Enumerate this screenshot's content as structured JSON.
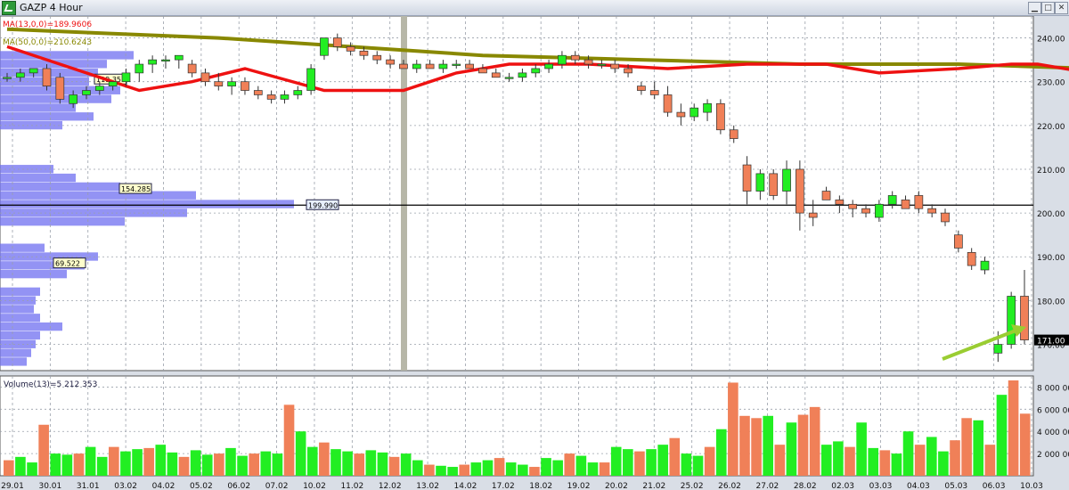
{
  "window": {
    "title": "GAZP 4 Hour",
    "min_label": "▁",
    "max_label": "□",
    "close_label": "✕"
  },
  "colors": {
    "bull": "#22ee22",
    "bear": "#f08058",
    "ma_fast": "#ee1111",
    "ma_slow": "#888800",
    "profile": "#6f6ff0",
    "grid": "#9aa0aa",
    "bg": "#ffffff",
    "highlight_arrow": "#9acd32"
  },
  "price_panel": {
    "ma_fast_label": "MA(13,0,0)=189.9606",
    "ma_slow_label": "MA(50,0,0)=210.6243",
    "current_price": "171.00",
    "ylim": [
      164,
      245
    ],
    "ticks": [
      170,
      180,
      190,
      200,
      210,
      220,
      230,
      240
    ],
    "tick_labels": [
      "170.00",
      "180.00",
      "190.00",
      "200.00",
      "210.00",
      "220.00",
      "230.00",
      "240.00"
    ],
    "hline": {
      "value": 201.8,
      "label": "199.990"
    },
    "profile_labels": [
      {
        "value": 230.5,
        "text": "119.351"
      },
      {
        "value": 205.5,
        "text": "154.285"
      },
      {
        "value": 188.5,
        "text": "69.522"
      }
    ]
  },
  "volume_panel": {
    "label": "Volume(13)=5 212 353",
    "ylim": [
      0,
      9000000
    ],
    "ticks": [
      2000000,
      4000000,
      6000000,
      8000000
    ],
    "tick_labels": [
      "2 000 000",
      "4 000 000",
      "6 000 000",
      "8 000 000"
    ]
  },
  "x_axis": {
    "labels": [
      "29.01",
      "30.01",
      "31.01",
      "03.02",
      "04.02",
      "05.02",
      "06.02",
      "07.02",
      "10.02",
      "11.02",
      "12.02",
      "13.02",
      "14.02",
      "17.02",
      "18.02",
      "19.02",
      "20.02",
      "21.02",
      "25.02",
      "26.02",
      "27.02",
      "28.02",
      "02.03",
      "03.03",
      "04.03",
      "05.03",
      "06.03",
      "10.03"
    ]
  },
  "chart_data": {
    "type": "candlestick",
    "title": "GAZP 4 Hour",
    "candles": [
      {
        "o": 231,
        "h": 232,
        "l": 230,
        "c": 231
      },
      {
        "o": 231,
        "h": 233,
        "l": 230,
        "c": 232
      },
      {
        "o": 232,
        "h": 233,
        "l": 231,
        "c": 233
      },
      {
        "o": 233,
        "h": 234,
        "l": 228,
        "c": 229
      },
      {
        "o": 231,
        "h": 232,
        "l": 225,
        "c": 226
      },
      {
        "o": 225,
        "h": 228,
        "l": 224,
        "c": 227
      },
      {
        "o": 227,
        "h": 229,
        "l": 226,
        "c": 228
      },
      {
        "o": 228,
        "h": 230,
        "l": 227,
        "c": 229
      },
      {
        "o": 229,
        "h": 230,
        "l": 228,
        "c": 230
      },
      {
        "o": 230,
        "h": 233,
        "l": 229,
        "c": 232
      },
      {
        "o": 232,
        "h": 235,
        "l": 230,
        "c": 234
      },
      {
        "o": 234,
        "h": 236,
        "l": 232,
        "c": 235
      },
      {
        "o": 235,
        "h": 236,
        "l": 233,
        "c": 235
      },
      {
        "o": 235,
        "h": 236,
        "l": 233,
        "c": 236
      },
      {
        "o": 234,
        "h": 235,
        "l": 231,
        "c": 232
      },
      {
        "o": 232,
        "h": 233,
        "l": 229,
        "c": 230
      },
      {
        "o": 230,
        "h": 232,
        "l": 228,
        "c": 229
      },
      {
        "o": 229,
        "h": 231,
        "l": 227,
        "c": 230
      },
      {
        "o": 230,
        "h": 231,
        "l": 227,
        "c": 228
      },
      {
        "o": 228,
        "h": 229,
        "l": 226,
        "c": 227
      },
      {
        "o": 227,
        "h": 228,
        "l": 225,
        "c": 226
      },
      {
        "o": 226,
        "h": 228,
        "l": 225,
        "c": 227
      },
      {
        "o": 227,
        "h": 229,
        "l": 226,
        "c": 228
      },
      {
        "o": 228,
        "h": 234,
        "l": 227,
        "c": 233
      },
      {
        "o": 236,
        "h": 240,
        "l": 235,
        "c": 240
      },
      {
        "o": 240,
        "h": 241,
        "l": 237,
        "c": 238
      },
      {
        "o": 238,
        "h": 239,
        "l": 236,
        "c": 237
      },
      {
        "o": 237,
        "h": 238,
        "l": 235,
        "c": 236
      },
      {
        "o": 236,
        "h": 237,
        "l": 234,
        "c": 235
      },
      {
        "o": 235,
        "h": 236,
        "l": 233,
        "c": 234
      },
      {
        "o": 234,
        "h": 235,
        "l": 233,
        "c": 233
      },
      {
        "o": 233,
        "h": 235,
        "l": 232,
        "c": 234
      },
      {
        "o": 234,
        "h": 235,
        "l": 233,
        "c": 233
      },
      {
        "o": 233,
        "h": 235,
        "l": 232,
        "c": 234
      },
      {
        "o": 234,
        "h": 235,
        "l": 233,
        "c": 234
      },
      {
        "o": 234,
        "h": 235,
        "l": 233,
        "c": 233
      },
      {
        "o": 233,
        "h": 234,
        "l": 232,
        "c": 232
      },
      {
        "o": 232,
        "h": 233,
        "l": 231,
        "c": 231
      },
      {
        "o": 231,
        "h": 232,
        "l": 230,
        "c": 231
      },
      {
        "o": 231,
        "h": 233,
        "l": 230,
        "c": 232
      },
      {
        "o": 232,
        "h": 234,
        "l": 231,
        "c": 233
      },
      {
        "o": 233,
        "h": 235,
        "l": 232,
        "c": 234
      },
      {
        "o": 234,
        "h": 237,
        "l": 233,
        "c": 236
      },
      {
        "o": 236,
        "h": 237,
        "l": 234,
        "c": 235
      },
      {
        "o": 235,
        "h": 236,
        "l": 233,
        "c": 234
      },
      {
        "o": 234,
        "h": 235,
        "l": 233,
        "c": 234
      },
      {
        "o": 234,
        "h": 235,
        "l": 232,
        "c": 233
      },
      {
        "o": 233,
        "h": 234,
        "l": 231,
        "c": 232
      },
      {
        "o": 229,
        "h": 230,
        "l": 227,
        "c": 228
      },
      {
        "o": 228,
        "h": 230,
        "l": 226,
        "c": 227
      },
      {
        "o": 227,
        "h": 229,
        "l": 222,
        "c": 223
      },
      {
        "o": 223,
        "h": 225,
        "l": 220,
        "c": 222
      },
      {
        "o": 222,
        "h": 225,
        "l": 221,
        "c": 224
      },
      {
        "o": 223,
        "h": 226,
        "l": 221,
        "c": 225
      },
      {
        "o": 225,
        "h": 226,
        "l": 218,
        "c": 219
      },
      {
        "o": 219,
        "h": 220,
        "l": 216,
        "c": 217
      },
      {
        "o": 211,
        "h": 213,
        "l": 202,
        "c": 205
      },
      {
        "o": 205,
        "h": 210,
        "l": 203,
        "c": 209
      },
      {
        "o": 209,
        "h": 210,
        "l": 203,
        "c": 204
      },
      {
        "o": 205,
        "h": 212,
        "l": 202,
        "c": 210
      },
      {
        "o": 210,
        "h": 212,
        "l": 196,
        "c": 200
      },
      {
        "o": 200,
        "h": 203,
        "l": 197,
        "c": 199
      },
      {
        "o": 205,
        "h": 206,
        "l": 203,
        "c": 203
      },
      {
        "o": 203,
        "h": 204,
        "l": 200,
        "c": 202
      },
      {
        "o": 202,
        "h": 203,
        "l": 199,
        "c": 201
      },
      {
        "o": 201,
        "h": 202,
        "l": 199,
        "c": 200
      },
      {
        "o": 199,
        "h": 203,
        "l": 198,
        "c": 202
      },
      {
        "o": 202,
        "h": 205,
        "l": 201,
        "c": 204
      },
      {
        "o": 203,
        "h": 204,
        "l": 201,
        "c": 201
      },
      {
        "o": 204,
        "h": 205,
        "l": 200,
        "c": 201
      },
      {
        "o": 201,
        "h": 202,
        "l": 199,
        "c": 200
      },
      {
        "o": 200,
        "h": 201,
        "l": 197,
        "c": 198
      },
      {
        "o": 195,
        "h": 196,
        "l": 191,
        "c": 192
      },
      {
        "o": 191,
        "h": 192,
        "l": 187,
        "c": 188
      },
      {
        "o": 187,
        "h": 190,
        "l": 186,
        "c": 189
      },
      {
        "o": 168,
        "h": 173,
        "l": 166,
        "c": 170
      },
      {
        "o": 170,
        "h": 182,
        "l": 169,
        "c": 181
      },
      {
        "o": 181,
        "h": 187,
        "l": 170,
        "c": 171
      }
    ],
    "volume": [
      1.4,
      1.7,
      1.2,
      4.6,
      2.0,
      1.9,
      2.0,
      2.6,
      1.7,
      2.6,
      2.2,
      2.4,
      2.5,
      2.8,
      2.1,
      1.7,
      2.3,
      1.9,
      2.0,
      2.5,
      1.8,
      2.0,
      2.2,
      2.0,
      6.4,
      4.0,
      2.6,
      3.0,
      2.4,
      2.2,
      2.0,
      2.3,
      2.1,
      1.7,
      2.0,
      1.4,
      1.0,
      0.9,
      0.8,
      1.0,
      1.2,
      1.4,
      1.6,
      1.2,
      1.0,
      0.8,
      1.6,
      1.4,
      2.0,
      1.8,
      1.2,
      1.2,
      2.6,
      2.4,
      2.2,
      2.4,
      2.8,
      3.4,
      2.0,
      1.8,
      2.6,
      4.2,
      8.4,
      5.4,
      5.2,
      5.4,
      2.8,
      4.8,
      5.5,
      6.2,
      2.8,
      3.1,
      2.6,
      4.8,
      2.5,
      2.3,
      2.0,
      4.0,
      2.8,
      3.5,
      2.2,
      3.2,
      5.2,
      5.0,
      2.8,
      7.3,
      8.6,
      5.6
    ],
    "ma_fast": [
      [
        0,
        238
      ],
      [
        6,
        232
      ],
      [
        10,
        228
      ],
      [
        14,
        230
      ],
      [
        18,
        233
      ],
      [
        24,
        228
      ],
      [
        30,
        228
      ],
      [
        34,
        232
      ],
      [
        38,
        234
      ],
      [
        44,
        234
      ],
      [
        50,
        233
      ],
      [
        56,
        234
      ],
      [
        62,
        234
      ],
      [
        66,
        232
      ],
      [
        72,
        233
      ],
      [
        76,
        234
      ],
      [
        78,
        234
      ],
      [
        82,
        232
      ],
      [
        88,
        230
      ],
      [
        94,
        226
      ],
      [
        98,
        220
      ],
      [
        104,
        214
      ],
      [
        108,
        209
      ],
      [
        112,
        205
      ],
      [
        118,
        205
      ],
      [
        124,
        203
      ],
      [
        130,
        198
      ],
      [
        136,
        188
      ],
      [
        140,
        187
      ]
    ],
    "ma_slow_line": [
      [
        0,
        242
      ],
      [
        8,
        241
      ],
      [
        16,
        240
      ],
      [
        26,
        238
      ],
      [
        36,
        236
      ],
      [
        48,
        235
      ],
      [
        60,
        234
      ],
      [
        72,
        234
      ],
      [
        82,
        233
      ],
      [
        90,
        229
      ],
      [
        98,
        227
      ],
      [
        104,
        223
      ],
      [
        110,
        221
      ],
      [
        118,
        217
      ],
      [
        124,
        213
      ],
      [
        130,
        210
      ],
      [
        136,
        206
      ],
      [
        140,
        204
      ]
    ],
    "price_profile": [
      {
        "v": 236,
        "w": 150
      },
      {
        "v": 234,
        "w": 120
      },
      {
        "v": 232,
        "w": 110
      },
      {
        "v": 230,
        "w": 100
      },
      {
        "v": 228,
        "w": 135
      },
      {
        "v": 226,
        "w": 125
      },
      {
        "v": 224,
        "w": 85
      },
      {
        "v": 222,
        "w": 105
      },
      {
        "v": 220,
        "w": 70
      },
      {
        "v": 210,
        "w": 60
      },
      {
        "v": 208,
        "w": 85
      },
      {
        "v": 206,
        "w": 135
      },
      {
        "v": 204,
        "w": 220
      },
      {
        "v": 202,
        "w": 330
      },
      {
        "v": 200,
        "w": 210
      },
      {
        "v": 198,
        "w": 140
      },
      {
        "v": 192,
        "w": 50
      },
      {
        "v": 190,
        "w": 110
      },
      {
        "v": 188,
        "w": 95
      },
      {
        "v": 186,
        "w": 75
      },
      {
        "v": 182,
        "w": 45
      },
      {
        "v": 180,
        "w": 40
      },
      {
        "v": 178,
        "w": 38
      },
      {
        "v": 176,
        "w": 45
      },
      {
        "v": 174,
        "w": 70
      },
      {
        "v": 172,
        "w": 45
      },
      {
        "v": 170,
        "w": 40
      },
      {
        "v": 168,
        "w": 35
      },
      {
        "v": 166,
        "w": 30
      }
    ]
  }
}
